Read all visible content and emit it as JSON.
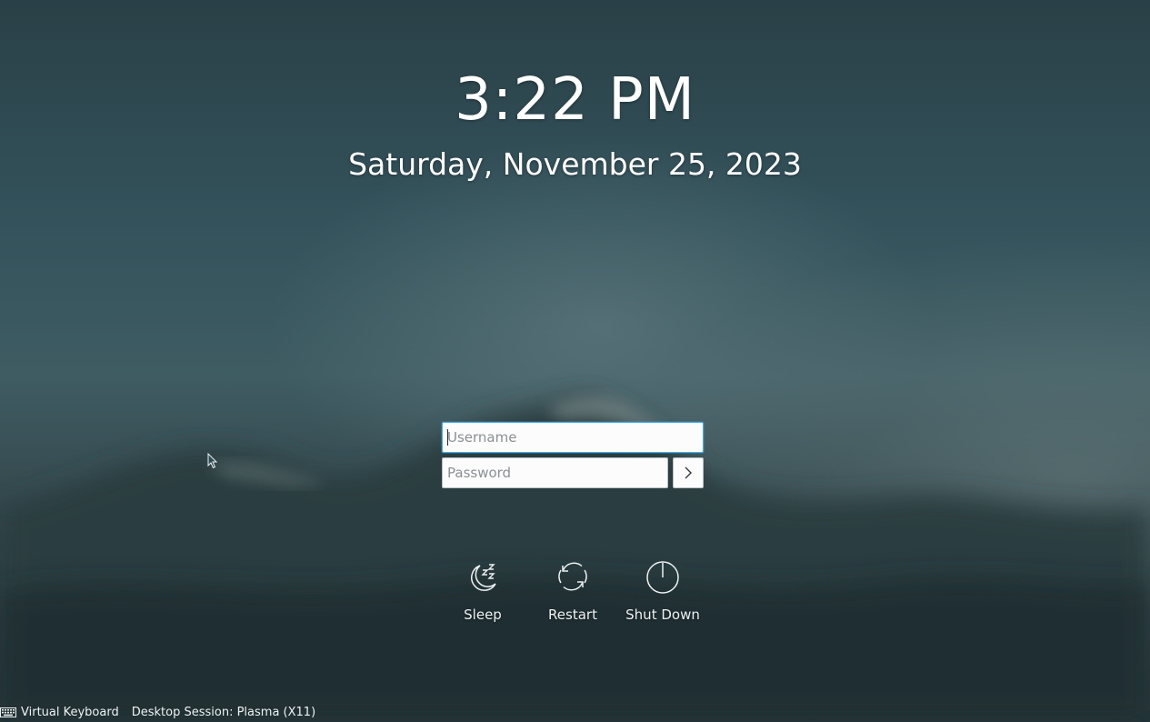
{
  "clock": {
    "time": "3:22 PM",
    "date": "Saturday, November 25, 2023"
  },
  "login": {
    "username_placeholder": "Username",
    "username_value": "",
    "password_placeholder": "Password",
    "password_value": "",
    "submit_icon": "chevron-right-icon"
  },
  "actions": [
    {
      "label": "Sleep",
      "icon": "sleep-icon"
    },
    {
      "label": "Restart",
      "icon": "restart-icon"
    },
    {
      "label": "Shut Down",
      "icon": "shutdown-icon"
    }
  ],
  "footer": {
    "virtual_keyboard_label": "Virtual Keyboard",
    "virtual_keyboard_icon": "keyboard-icon",
    "session_label": "Desktop Session: Plasma (X11)"
  },
  "colors": {
    "accent": "#3daee9",
    "background": "#2f4c55"
  }
}
